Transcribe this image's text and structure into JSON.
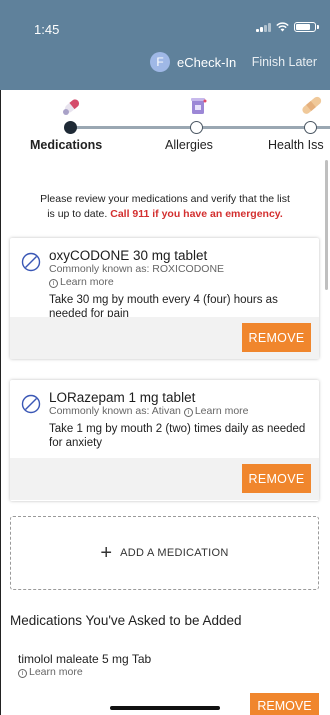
{
  "status_bar": {
    "time": "1:45"
  },
  "header": {
    "avatar_initial": "F",
    "title": "eCheck-In",
    "finish_label": "Finish Later"
  },
  "steps": [
    {
      "label": "Medications",
      "active": true,
      "icon": "pills-icon"
    },
    {
      "label": "Allergies",
      "active": false,
      "icon": "allergy-bottle-icon"
    },
    {
      "label": "Health Iss",
      "active": false,
      "icon": "bandage-icon"
    }
  ],
  "intro": {
    "text_line1": "Please review your medications and verify that the list",
    "text_line2_prefix": "is up to date.",
    "emergency": "Call 911 if you have an emergency."
  },
  "medications": [
    {
      "name": "oxyCODONE 30 mg tablet",
      "common": "Commonly known as: ROXICODONE",
      "learn_more": "Learn more",
      "sig": "Take 30 mg by mouth every 4 (four) hours as needed for pain",
      "remove_label": "REMOVE"
    },
    {
      "name": "LORazepam 1 mg tablet",
      "common": "Commonly known as: Ativan",
      "learn_more": "Learn more",
      "sig": "Take 1 mg by mouth 2 (two) times daily as needed for anxiety",
      "remove_label": "REMOVE"
    }
  ],
  "add_medication_label": "ADD A MEDICATION",
  "asked_section": {
    "title": "Medications You've Asked to be Added",
    "items": [
      {
        "name": "timolol maleate 5 mg Tab",
        "learn_more": "Learn more",
        "remove_label": "REMOVE"
      }
    ]
  },
  "colors": {
    "header_bg": "#5f819b",
    "accent_orange": "#f0862d",
    "emergency_red": "#d32f2f"
  }
}
